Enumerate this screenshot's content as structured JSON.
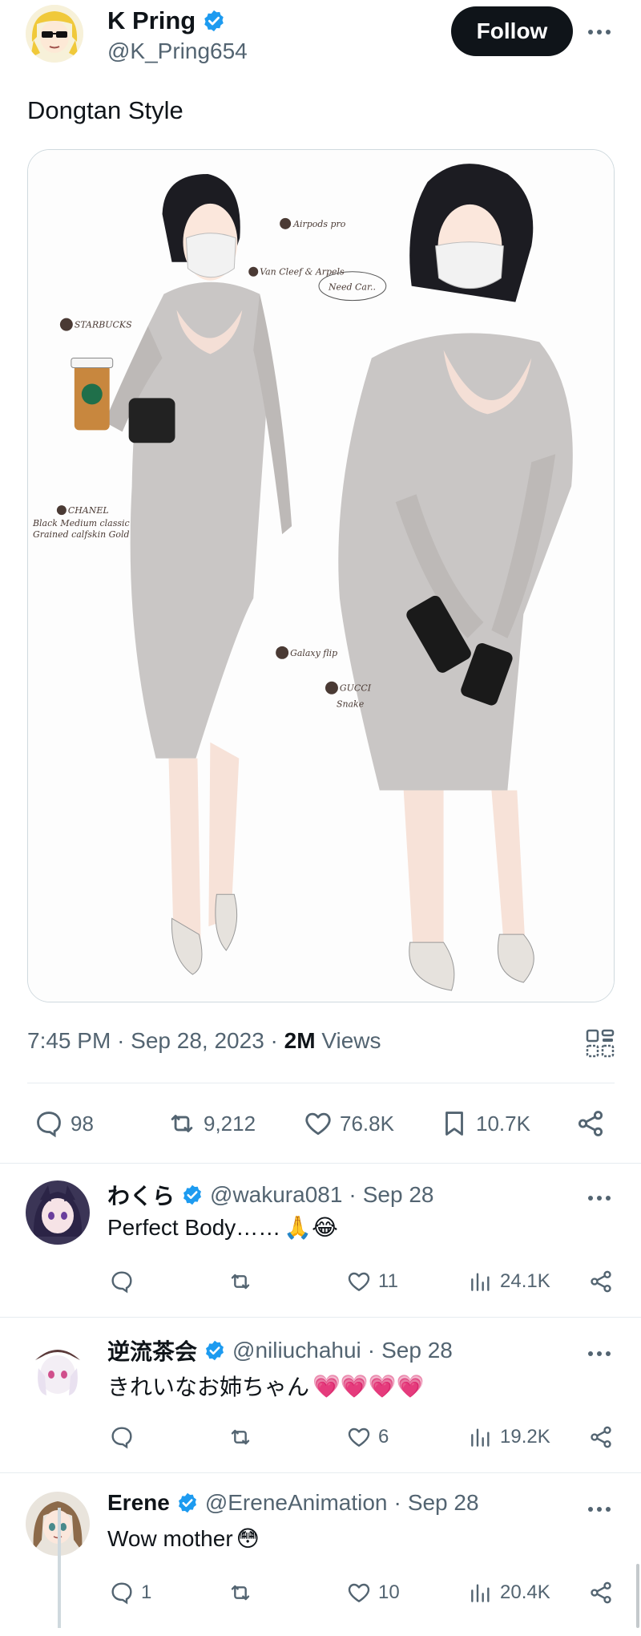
{
  "post": {
    "author": {
      "name": "K Pring",
      "handle": "@K_Pring654",
      "avatar_icon": "blonde-avatar-sunglasses"
    },
    "follow_label": "Follow",
    "text": "Dongtan Style",
    "image": {
      "left_labels": [
        "STARBUCKS",
        "CHANEL",
        "Black Medium classic",
        "Grained calfskin Gold"
      ],
      "right_labels": [
        "Airpods pro",
        "Van Cleef & Arpels",
        "Need Car..",
        "Galaxy flip",
        "GUCCI",
        "Snake"
      ]
    },
    "meta": {
      "time": "7:45 PM",
      "date": "Sep 28, 2023",
      "views_count": "2M",
      "views_label": "Views"
    },
    "stats": {
      "replies": "98",
      "reposts": "9,212",
      "likes": "76.8K",
      "bookmarks": "10.7K"
    }
  },
  "replies": [
    {
      "name": "わくら",
      "handle": "@wakura081",
      "date": "Sep 28",
      "text": "Perfect Body……",
      "emojis": "🙏😂",
      "replies": "",
      "reposts": "",
      "likes": "11",
      "views": "24.1K"
    },
    {
      "name": "逆流茶会",
      "handle": "@niliuchahui",
      "date": "Sep 28",
      "text": "きれいなお姉ちゃん",
      "emojis": "💗💗💗💗",
      "replies": "",
      "reposts": "",
      "likes": "6",
      "views": "19.2K"
    },
    {
      "name": "Erene",
      "handle": "@EreneAnimation",
      "date": "Sep 28",
      "text": "Wow mother",
      "emojis": "😳",
      "replies": "1",
      "reposts": "",
      "likes": "10",
      "views": "20.4K"
    }
  ],
  "colors": {
    "verified": "#1d9bf0",
    "text_primary": "#0f1419",
    "text_secondary": "#536471",
    "border": "#e6ecf0",
    "follow_bg": "#0f1419"
  },
  "separator": "·"
}
